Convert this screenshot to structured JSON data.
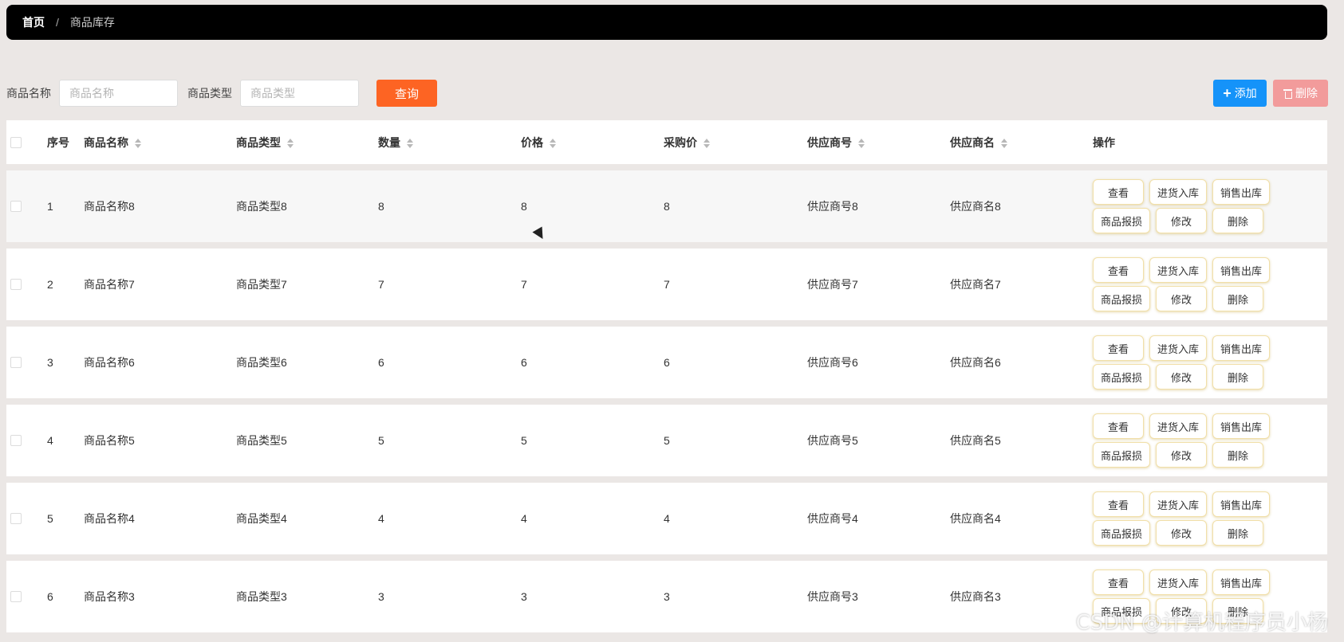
{
  "breadcrumb": {
    "home": "首页",
    "separator": "/",
    "current": "商品库存"
  },
  "search": {
    "name_label": "商品名称",
    "name_placeholder": "商品名称",
    "type_label": "商品类型",
    "type_placeholder": "商品类型",
    "query_label": "查询",
    "add_label": "添加",
    "delete_label": "删除"
  },
  "table": {
    "headers": [
      "序号",
      "商品名称",
      "商品类型",
      "数量",
      "价格",
      "采购价",
      "供应商号",
      "供应商名",
      "操作"
    ],
    "rows": [
      {
        "index": "1",
        "name": "商品名称8",
        "type": "商品类型8",
        "qty": "8",
        "price": "8",
        "purchase": "8",
        "supplier_id": "供应商号8",
        "supplier_name": "供应商名8"
      },
      {
        "index": "2",
        "name": "商品名称7",
        "type": "商品类型7",
        "qty": "7",
        "price": "7",
        "purchase": "7",
        "supplier_id": "供应商号7",
        "supplier_name": "供应商名7"
      },
      {
        "index": "3",
        "name": "商品名称6",
        "type": "商品类型6",
        "qty": "6",
        "price": "6",
        "purchase": "6",
        "supplier_id": "供应商号6",
        "supplier_name": "供应商名6"
      },
      {
        "index": "4",
        "name": "商品名称5",
        "type": "商品类型5",
        "qty": "5",
        "price": "5",
        "purchase": "5",
        "supplier_id": "供应商号5",
        "supplier_name": "供应商名5"
      },
      {
        "index": "5",
        "name": "商品名称4",
        "type": "商品类型4",
        "qty": "4",
        "price": "4",
        "purchase": "4",
        "supplier_id": "供应商号4",
        "supplier_name": "供应商名4"
      },
      {
        "index": "6",
        "name": "商品名称3",
        "type": "商品类型3",
        "qty": "3",
        "price": "3",
        "purchase": "3",
        "supplier_id": "供应商号3",
        "supplier_name": "供应商名3"
      }
    ],
    "actions": [
      "查看",
      "进货入库",
      "销售出库",
      "商品报损",
      "修改",
      "删除"
    ]
  },
  "watermark": "CSDN @计算机程序员小杨",
  "colors": {
    "query": "#fd6423",
    "add": "#1593f9",
    "delete": "#f29b9b",
    "breadcrumb_bg": "#000000"
  },
  "icons": {
    "add": "plus-icon",
    "delete": "trash-icon",
    "sort": "sort-icon",
    "cursor": "mouse-cursor-icon"
  }
}
